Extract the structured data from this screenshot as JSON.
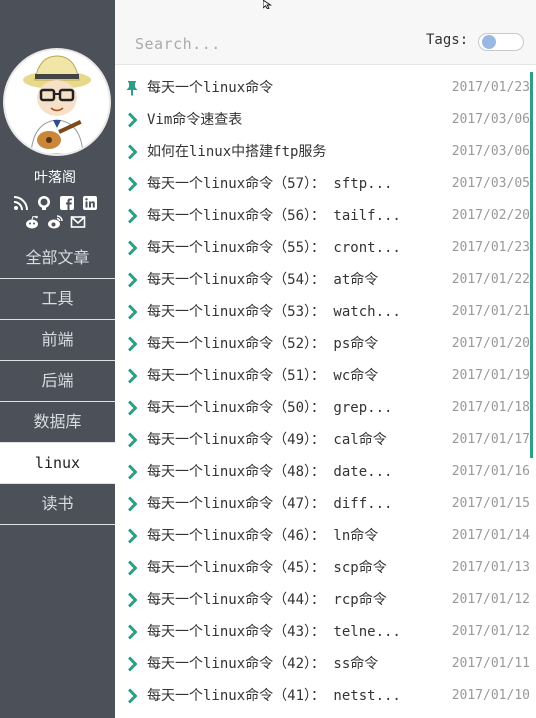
{
  "sidebar": {
    "author": "叶落阁",
    "social_icons": {
      "row1": [
        "rss-icon",
        "github-icon",
        "facebook-icon",
        "linkedin-icon"
      ],
      "row2": [
        "reddit-icon",
        "weibo-icon",
        "mail-icon"
      ]
    },
    "categories": [
      {
        "label": "全部文章",
        "active": false
      },
      {
        "label": "工具",
        "active": false
      },
      {
        "label": "前端",
        "active": false
      },
      {
        "label": "后端",
        "active": false
      },
      {
        "label": "数据库",
        "active": false
      },
      {
        "label": "linux",
        "active": true
      },
      {
        "label": "读书",
        "active": false
      }
    ]
  },
  "header": {
    "search_placeholder": "Search...",
    "tags_label": "Tags:",
    "tags_enabled": false
  },
  "colors": {
    "sidebar_bg": "#4b5059",
    "accent": "#2f9e86",
    "toggle_knob": "#9ab8e3"
  },
  "posts": [
    {
      "title": "每天一个linux命令",
      "date": "2017/01/23",
      "icon": "pin-icon"
    },
    {
      "title": "Vim命令速查表",
      "date": "2017/03/06",
      "icon": "chevron-right-icon"
    },
    {
      "title": "如何在linux中搭建ftp服务",
      "date": "2017/03/06",
      "icon": "chevron-right-icon"
    },
    {
      "title": "每天一个linux命令（57）： sftp...",
      "date": "2017/03/05",
      "icon": "chevron-right-icon"
    },
    {
      "title": "每天一个linux命令（56）： tailf...",
      "date": "2017/02/20",
      "icon": "chevron-right-icon"
    },
    {
      "title": "每天一个linux命令（55）： cront...",
      "date": "2017/01/23",
      "icon": "chevron-right-icon"
    },
    {
      "title": "每天一个linux命令（54）： at命令",
      "date": "2017/01/22",
      "icon": "chevron-right-icon"
    },
    {
      "title": "每天一个linux命令（53）： watch...",
      "date": "2017/01/21",
      "icon": "chevron-right-icon"
    },
    {
      "title": "每天一个linux命令（52）： ps命令",
      "date": "2017/01/20",
      "icon": "chevron-right-icon"
    },
    {
      "title": "每天一个linux命令（51）： wc命令",
      "date": "2017/01/19",
      "icon": "chevron-right-icon"
    },
    {
      "title": "每天一个linux命令（50）： grep...",
      "date": "2017/01/18",
      "icon": "chevron-right-icon"
    },
    {
      "title": "每天一个linux命令（49）： cal命令",
      "date": "2017/01/17",
      "icon": "chevron-right-icon"
    },
    {
      "title": "每天一个linux命令（48）： date...",
      "date": "2017/01/16",
      "icon": "chevron-right-icon"
    },
    {
      "title": "每天一个linux命令（47）： diff...",
      "date": "2017/01/15",
      "icon": "chevron-right-icon"
    },
    {
      "title": "每天一个linux命令（46）： ln命令",
      "date": "2017/01/14",
      "icon": "chevron-right-icon"
    },
    {
      "title": "每天一个linux命令（45）： scp命令",
      "date": "2017/01/13",
      "icon": "chevron-right-icon"
    },
    {
      "title": "每天一个linux命令（44）： rcp命令",
      "date": "2017/01/12",
      "icon": "chevron-right-icon"
    },
    {
      "title": "每天一个linux命令（43）： telne...",
      "date": "2017/01/12",
      "icon": "chevron-right-icon"
    },
    {
      "title": "每天一个linux命令（42）： ss命令",
      "date": "2017/01/11",
      "icon": "chevron-right-icon"
    },
    {
      "title": "每天一个linux命令（41）： netst...",
      "date": "2017/01/10",
      "icon": "chevron-right-icon"
    }
  ]
}
